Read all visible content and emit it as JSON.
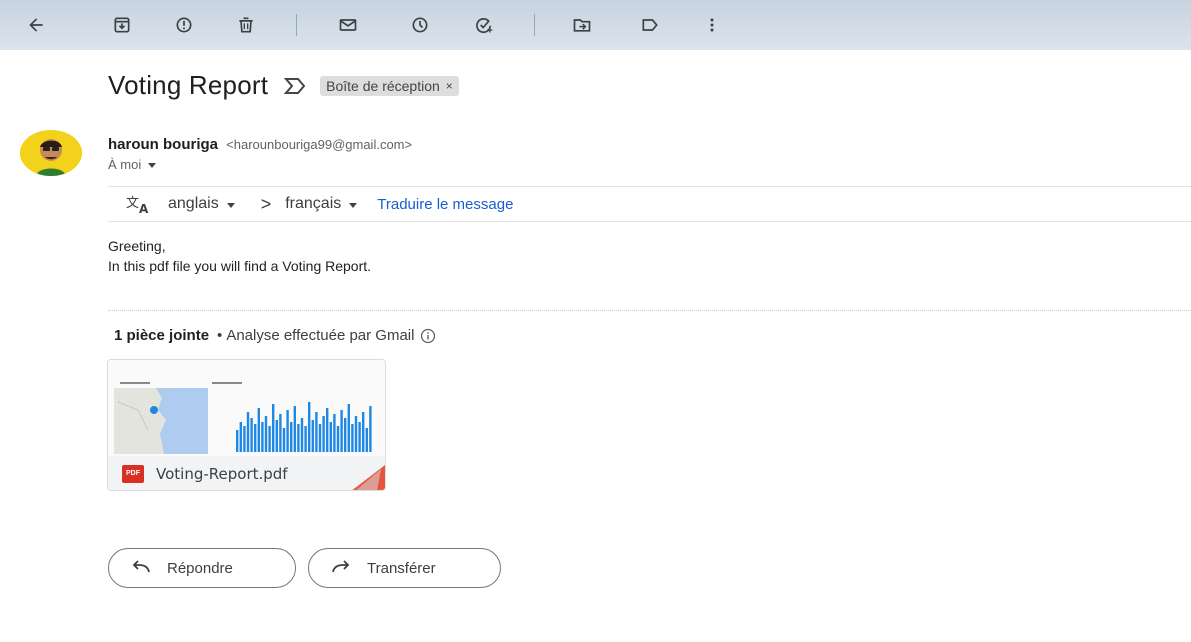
{
  "toolbar": {
    "icons": [
      "back-arrow-icon",
      "archive-icon",
      "report-spam-icon",
      "delete-icon",
      "mark-unread-icon",
      "snooze-icon",
      "add-task-icon",
      "move-to-icon",
      "label-icon",
      "more-icon"
    ],
    "background": "#c7d3e0"
  },
  "message": {
    "subject": "Voting Report",
    "label_chip": "Boîte de réception",
    "label_chip_close": "×",
    "sender_name": "haroun bouriga",
    "sender_email": "<harounbouriga99@gmail.com>",
    "to_line": "À moi"
  },
  "translate": {
    "source_lang": "anglais",
    "arrow": ">",
    "target_lang": "français",
    "link": "Traduire le message"
  },
  "body": {
    "line1": "Greeting,",
    "line2": "In this pdf file you will find a Voting Report."
  },
  "attachments": {
    "count_label": "1 pièce jointe",
    "dot": "•",
    "scan_label": "Analyse effectuée par Gmail",
    "file": {
      "name": "Voting-Report.pdf",
      "badge": "PDF"
    }
  },
  "actions": {
    "reply": "Répondre",
    "forward": "Transférer"
  },
  "colors": {
    "link": "#1a5fd0",
    "pdf_red": "#d93025",
    "chart_blue": "#1e88e5"
  }
}
